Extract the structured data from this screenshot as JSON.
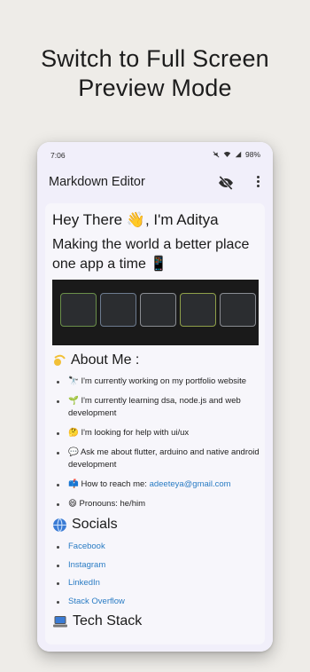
{
  "headline": {
    "line1": "Switch to Full Screen",
    "line2": "Preview Mode"
  },
  "status_bar": {
    "time": "7:06",
    "battery": "98%"
  },
  "app_bar": {
    "title": "Markdown Editor",
    "icons": [
      "eye-off-icon",
      "more-vert-icon"
    ]
  },
  "preview": {
    "heading": "Hey There 👋, I'm Aditya",
    "subheading": "Making the world a better place one app a time 📱",
    "about": {
      "title": "About Me :",
      "items": [
        "🔭 I'm currently working on my portfolio website",
        "🌱 I'm currently learning dsa, node.js and web development",
        "🤔 I'm looking for help with ui/ux",
        "💬 Ask me about flutter, arduino and native android development"
      ],
      "reach_prefix": "📫 How to reach me: ",
      "reach_email": "adeeteya@gmail.com",
      "pronouns": "😄 Pronouns: he/him"
    },
    "socials": {
      "title": "Socials",
      "links": [
        "Facebook",
        "Instagram",
        "LinkedIn",
        "Stack Overflow"
      ]
    },
    "tech": {
      "title": "Tech Stack"
    }
  },
  "colors": {
    "link": "#2a7cc4",
    "appbar_bg": "#f1effa",
    "page_bg": "#eeece8"
  }
}
